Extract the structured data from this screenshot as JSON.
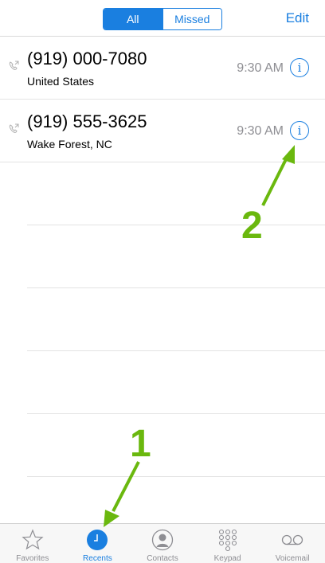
{
  "segments": {
    "all_label": "All",
    "missed_label": "Missed"
  },
  "edit_label": "Edit",
  "calls": [
    {
      "number": "(919) 000-7080",
      "location": "United States",
      "time": "9:30 AM"
    },
    {
      "number": "(919) 555-3625",
      "location": "Wake Forest, NC",
      "time": "9:30 AM"
    }
  ],
  "tabs": [
    {
      "label": "Favorites",
      "icon": "star-icon"
    },
    {
      "label": "Recents",
      "icon": "clock-icon"
    },
    {
      "label": "Contacts",
      "icon": "person-icon"
    },
    {
      "label": "Keypad",
      "icon": "keypad-icon"
    },
    {
      "label": "Voicemail",
      "icon": "voicemail-icon"
    }
  ],
  "annotations": {
    "marker_1": "1",
    "marker_2": "2"
  },
  "colors": {
    "accent": "#1a7fe0",
    "annotation": "#6ab80e"
  }
}
